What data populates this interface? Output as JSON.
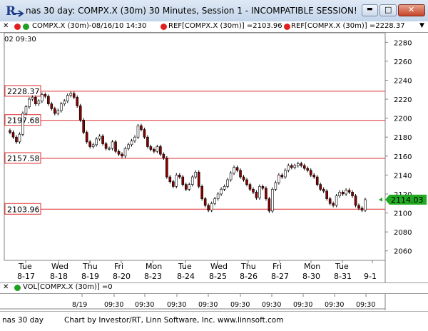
{
  "window": {
    "title": "nas 30 day: COMPX.X (30m) 30 Minutes, Session 1 - INCOMPATIBLE SESSION!",
    "close_glyph": "✕",
    "minimize_glyph": "▬",
    "maximize_glyph": "□"
  },
  "infobar": {
    "close_glyph": "✕",
    "symbol_text": "COMPX.X (30m)-08/16/10 14:30",
    "ref1_text": "REF[COMPX.X (30m)] =2103.96",
    "ref2_text": "REF[COMPX.X (30m)] =2228.37",
    "arrow_glyph": "▼"
  },
  "top_time_label": "02  09:30",
  "ref_lines": [
    {
      "label": "2228.37",
      "value": 2228.37
    },
    {
      "label": "2197.68",
      "value": 2197.68
    },
    {
      "label": "2157.58",
      "value": 2157.58
    },
    {
      "label": "2103.96",
      "value": 2103.96
    }
  ],
  "current_price_label": "2114.03",
  "current_price": 2114.03,
  "y_axis": {
    "min": 2050,
    "max": 2290,
    "ticks": [
      "2280",
      "2260",
      "2240",
      "2220",
      "2200",
      "2180",
      "2160",
      "2140",
      "2120",
      "2100",
      "2080",
      "2060"
    ],
    "tick_values": [
      2280,
      2260,
      2240,
      2220,
      2200,
      2180,
      2160,
      2140,
      2120,
      2100,
      2080,
      2060
    ]
  },
  "x_axis": {
    "days": [
      {
        "day": "Tue",
        "date": "8-17"
      },
      {
        "day": "Wed",
        "date": "8-18"
      },
      {
        "day": "Thu",
        "date": "8-19"
      },
      {
        "day": "Fri",
        "date": "8-20"
      },
      {
        "day": "Mon",
        "date": "8-23"
      },
      {
        "day": "Tue",
        "date": "8-24"
      },
      {
        "day": "Wed",
        "date": "8-25"
      },
      {
        "day": "Thu",
        "date": "8-26"
      },
      {
        "day": "Fri",
        "date": "8-27"
      },
      {
        "day": "Mon",
        "date": "8-30"
      },
      {
        "day": "Tue",
        "date": "8-31"
      },
      {
        "day": "",
        "date": "9-1"
      }
    ]
  },
  "volume_panel": {
    "label": "VOL[COMPX.X (30m)] =0",
    "bottom_labels": [
      "8/19",
      "09:30",
      "09:30",
      "09:30",
      "09:30",
      "09:30",
      "09:30",
      "09:30",
      "09:30",
      "09:30"
    ]
  },
  "status": {
    "left": "nas 30 day",
    "center": "Chart by Investor/RT, Linn Software, Inc. www.linnsoft.com"
  },
  "colors": {
    "ref_line": "#e03030",
    "bull_candle": "#ffffff",
    "bear_candle": "#8b0000",
    "price_tag": "#22aa22",
    "dot_red": "#e02020",
    "dot_green": "#20a020"
  },
  "chart_data": {
    "type": "candlestick",
    "series": [
      {
        "name": "COMPX.X (30m)",
        "close": [
          2185,
          2180,
          2175,
          2183,
          2205,
          2212,
          2220,
          2222,
          2215,
          2218,
          2225,
          2223,
          2215,
          2210,
          2205,
          2208,
          2215,
          2218,
          2224,
          2226,
          2222,
          2213,
          2198,
          2185,
          2175,
          2170,
          2172,
          2178,
          2181,
          2173,
          2168,
          2168,
          2175,
          2165,
          2162,
          2160,
          2168,
          2172,
          2176,
          2180,
          2192,
          2188,
          2180,
          2170,
          2167,
          2165,
          2170,
          2162,
          2158,
          2138,
          2133,
          2128,
          2140,
          2138,
          2130,
          2125,
          2130,
          2138,
          2143,
          2128,
          2115,
          2108,
          2103,
          2110,
          2115,
          2120,
          2125,
          2128,
          2135,
          2142,
          2148,
          2145,
          2138,
          2135,
          2130,
          2125,
          2122,
          2116,
          2128,
          2126,
          2115,
          2102,
          2125,
          2132,
          2140,
          2138,
          2145,
          2150,
          2148,
          2150,
          2152,
          2150,
          2147,
          2145,
          2140,
          2138,
          2130,
          2125,
          2123,
          2115,
          2110,
          2108,
          2118,
          2122,
          2120,
          2124,
          2122,
          2118,
          2108,
          2105,
          2103,
          2114
        ]
      }
    ]
  }
}
